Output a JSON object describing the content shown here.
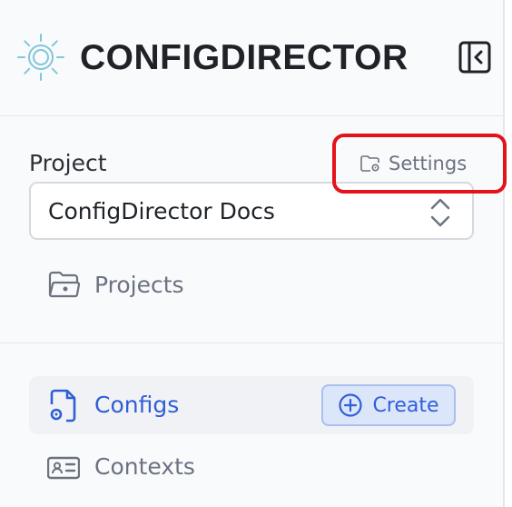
{
  "app": {
    "title": "CONFIGDIRECTOR"
  },
  "project": {
    "label": "Project",
    "settings_label": "Settings",
    "selected": "ConfigDirector Docs",
    "projects_link": "Projects"
  },
  "nav": {
    "items": [
      {
        "label": "Configs",
        "active": true,
        "action_label": "Create"
      },
      {
        "label": "Contexts",
        "active": false
      }
    ]
  },
  "colors": {
    "accent": "#2f5ed8",
    "highlight": "#e3131b",
    "logo": "#7fc7d9"
  }
}
